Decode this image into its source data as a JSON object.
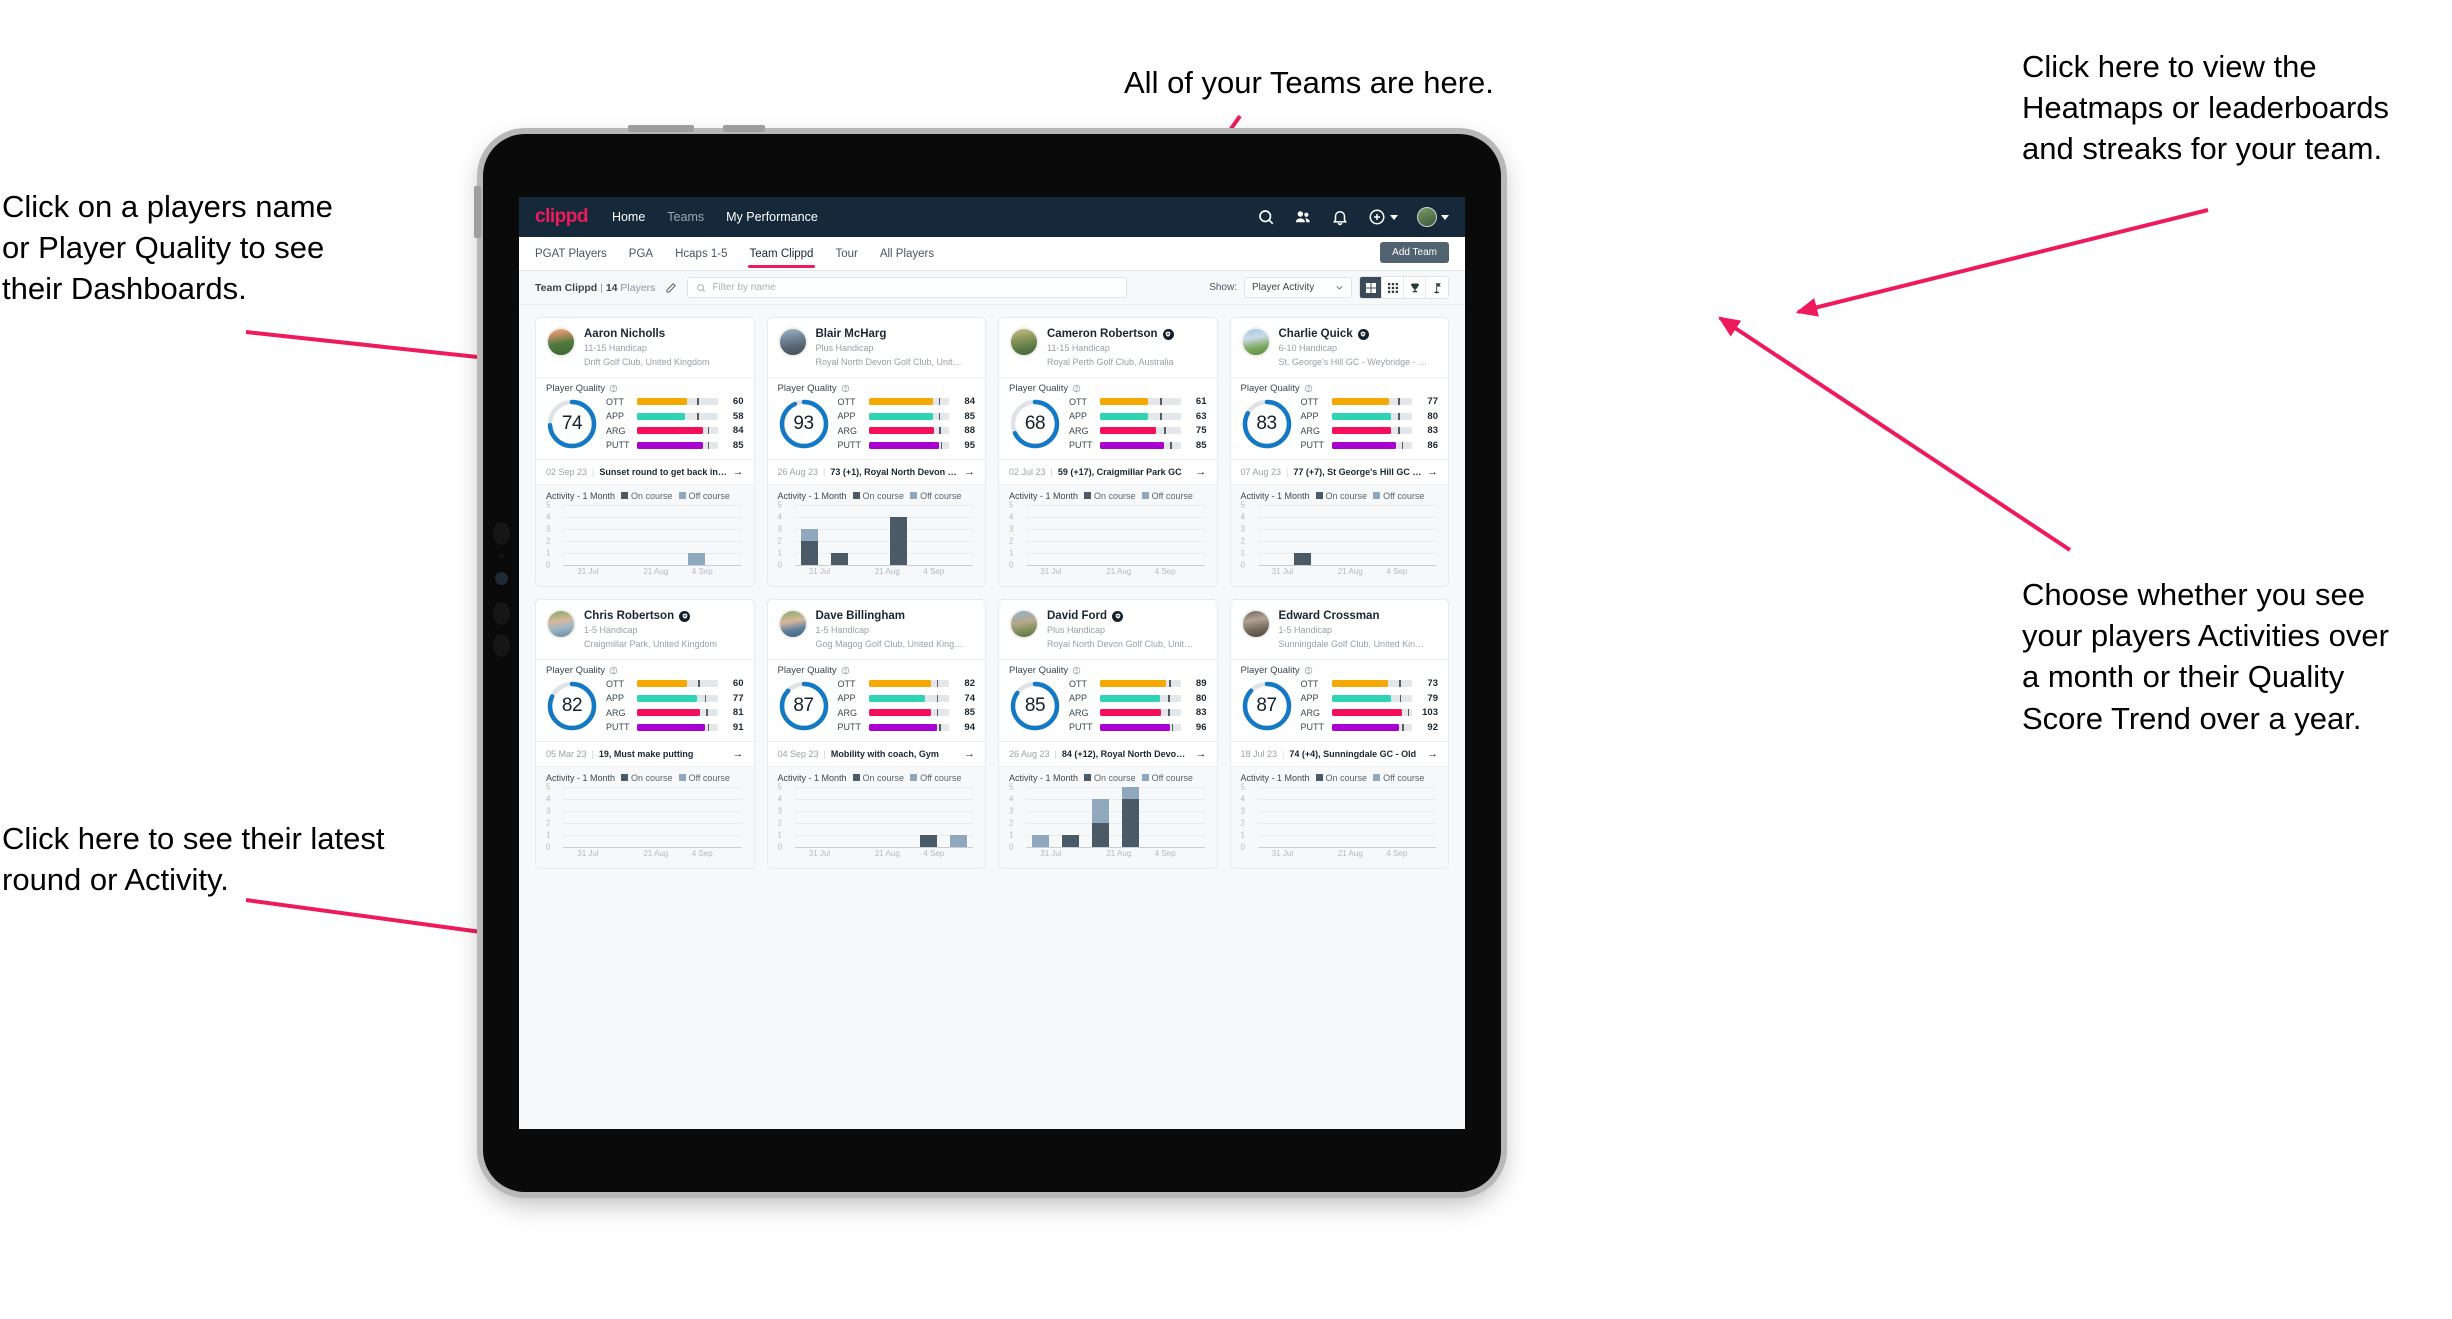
{
  "annotations": [
    {
      "id": "a-left-top",
      "text": "Click on a players name\nor Player Quality to see\ntheir Dashboards."
    },
    {
      "id": "a-top",
      "text": "All of your Teams are here."
    },
    {
      "id": "a-right-top",
      "text": "Click here to view the\nHeatmaps or leaderboards\nand streaks for your team."
    },
    {
      "id": "a-right-bottom",
      "text": "Choose whether you see\nyour players Activities over\na month or their Quality\nScore Trend over a year."
    },
    {
      "id": "a-left-bottom",
      "text": "Click here to see their latest\nround or Activity."
    }
  ],
  "topbar": {
    "logo": "clippd",
    "links": [
      {
        "label": "Home",
        "active": true
      },
      {
        "label": "Teams",
        "active": false
      },
      {
        "label": "My Performance",
        "active": false
      }
    ],
    "icons": [
      "search-icon",
      "people-icon",
      "bell-icon",
      "plus-circle-icon",
      "avatar"
    ]
  },
  "subtabs": {
    "tabs": [
      {
        "label": "PGAT Players",
        "active": false
      },
      {
        "label": "PGA",
        "active": false
      },
      {
        "label": "Hcaps 1-5",
        "active": false
      },
      {
        "label": "Team Clippd",
        "active": true
      },
      {
        "label": "Tour",
        "active": false
      },
      {
        "label": "All Players",
        "active": false
      }
    ],
    "add_team_label": "Add Team"
  },
  "filterbar": {
    "team_name": "Team Clippd",
    "separator": "|",
    "player_count": "14",
    "players_word": "Players",
    "edit_icon": "pencil-icon",
    "search_placeholder": "Filter by name",
    "show_label": "Show:",
    "show_value": "Player Activity",
    "view_buttons": [
      {
        "name": "grid-large-view",
        "active": true
      },
      {
        "name": "grid-small-view",
        "active": false
      },
      {
        "name": "trophy-leaderboard-view",
        "active": false
      },
      {
        "name": "golf-flag-view",
        "active": false
      }
    ]
  },
  "colors": {
    "accent_pink": "#ef1a5b",
    "navy": "#16293a",
    "ring_blue": "#1479c4",
    "ott": "#f5a800",
    "app": "#2fd4b5",
    "arg": "#f50f5a",
    "putt": "#a800d0",
    "on_course": "#4a5a66",
    "off_course": "#8fa8bd"
  },
  "card_labels": {
    "player_quality": "Player Quality",
    "activity": "Activity - 1 Month",
    "on_course": "On course",
    "off_course": "Off course",
    "metrics": [
      "OTT",
      "APP",
      "ARG",
      "PUTT"
    ],
    "y_ticks": [
      "5",
      "4",
      "3",
      "2",
      "1",
      "0"
    ],
    "x_ticks": [
      "31 Jul",
      "21 Aug",
      "4 Sep"
    ]
  },
  "players": [
    {
      "name": "Aaron Nicholls",
      "verified": false,
      "avatar_class": "pa0",
      "handicap": "11-15 Handicap",
      "club": "Drift Golf Club, United Kingdom",
      "quality": 74,
      "metrics": [
        {
          "key": "OTT",
          "value": 60,
          "fill": 62,
          "tick": 75
        },
        {
          "key": "APP",
          "value": 58,
          "fill": 60,
          "tick": 75
        },
        {
          "key": "ARG",
          "value": 84,
          "fill": 82,
          "tick": 88
        },
        {
          "key": "PUTT",
          "value": 85,
          "fill": 82,
          "tick": 88
        }
      ],
      "latest_date": "02 Sep 23",
      "latest_text": "Sunset round to get back into it, F...",
      "activity": [
        {
          "on": 0,
          "off": 0
        },
        {
          "on": 0,
          "off": 0
        },
        {
          "on": 0,
          "off": 0
        },
        {
          "on": 0,
          "off": 0
        },
        {
          "on": 0,
          "off": 1
        },
        {
          "on": 0,
          "off": 0
        }
      ]
    },
    {
      "name": "Blair McHarg",
      "verified": false,
      "avatar_class": "pa1",
      "handicap": "Plus Handicap",
      "club": "Royal North Devon Golf Club, United Kin...",
      "quality": 93,
      "metrics": [
        {
          "key": "OTT",
          "value": 84,
          "fill": 80,
          "tick": 87
        },
        {
          "key": "APP",
          "value": 85,
          "fill": 80,
          "tick": 87
        },
        {
          "key": "ARG",
          "value": 88,
          "fill": 81,
          "tick": 88
        },
        {
          "key": "PUTT",
          "value": 95,
          "fill": 87,
          "tick": 90
        }
      ],
      "latest_date": "26 Aug 23",
      "latest_text": "73 (+1), Royal North Devon GC",
      "activity": [
        {
          "on": 2,
          "off": 1
        },
        {
          "on": 1,
          "off": 0
        },
        {
          "on": 0,
          "off": 0
        },
        {
          "on": 4,
          "off": 0
        },
        {
          "on": 0,
          "off": 0
        },
        {
          "on": 0,
          "off": 0
        }
      ]
    },
    {
      "name": "Cameron Robertson",
      "verified": true,
      "avatar_class": "pa2",
      "handicap": "11-15 Handicap",
      "club": "Royal Perth Golf Club, Australia",
      "quality": 68,
      "metrics": [
        {
          "key": "OTT",
          "value": 61,
          "fill": 60,
          "tick": 75
        },
        {
          "key": "APP",
          "value": 63,
          "fill": 60,
          "tick": 75
        },
        {
          "key": "ARG",
          "value": 75,
          "fill": 70,
          "tick": 80
        },
        {
          "key": "PUTT",
          "value": 85,
          "fill": 80,
          "tick": 87
        }
      ],
      "latest_date": "02 Jul 23",
      "latest_text": "59 (+17), Craigmillar Park GC",
      "activity": [
        {
          "on": 0,
          "off": 0
        },
        {
          "on": 0,
          "off": 0
        },
        {
          "on": 0,
          "off": 0
        },
        {
          "on": 0,
          "off": 0
        },
        {
          "on": 0,
          "off": 0
        },
        {
          "on": 0,
          "off": 0
        }
      ]
    },
    {
      "name": "Charlie Quick",
      "verified": true,
      "avatar_class": "pa3",
      "handicap": "6-10 Handicap",
      "club": "St. George's Hill GC - Weybridge - Surrey, ...",
      "quality": 83,
      "metrics": [
        {
          "key": "OTT",
          "value": 77,
          "fill": 72,
          "tick": 83
        },
        {
          "key": "APP",
          "value": 80,
          "fill": 74,
          "tick": 83
        },
        {
          "key": "ARG",
          "value": 83,
          "fill": 74,
          "tick": 83
        },
        {
          "key": "PUTT",
          "value": 86,
          "fill": 80,
          "tick": 87
        }
      ],
      "latest_date": "07 Aug 23",
      "latest_text": "77 (+7), St George's Hill GC - Red...",
      "activity": [
        {
          "on": 0,
          "off": 0
        },
        {
          "on": 1,
          "off": 0
        },
        {
          "on": 0,
          "off": 0
        },
        {
          "on": 0,
          "off": 0
        },
        {
          "on": 0,
          "off": 0
        },
        {
          "on": 0,
          "off": 0
        }
      ]
    },
    {
      "name": "Chris Robertson",
      "verified": true,
      "avatar_class": "pa4",
      "handicap": "1-5 Handicap",
      "club": "Craigmillar Park, United Kingdom",
      "quality": 82,
      "metrics": [
        {
          "key": "OTT",
          "value": 60,
          "fill": 62,
          "tick": 76
        },
        {
          "key": "APP",
          "value": 77,
          "fill": 74,
          "tick": 84
        },
        {
          "key": "ARG",
          "value": 81,
          "fill": 78,
          "tick": 86
        },
        {
          "key": "PUTT",
          "value": 91,
          "fill": 84,
          "tick": 88
        }
      ],
      "latest_date": "05 Mar 23",
      "latest_text": "19, Must make putting",
      "activity": [
        {
          "on": 0,
          "off": 0
        },
        {
          "on": 0,
          "off": 0
        },
        {
          "on": 0,
          "off": 0
        },
        {
          "on": 0,
          "off": 0
        },
        {
          "on": 0,
          "off": 0
        },
        {
          "on": 0,
          "off": 0
        }
      ]
    },
    {
      "name": "Dave Billingham",
      "verified": false,
      "avatar_class": "pa5",
      "handicap": "1-5 Handicap",
      "club": "Gog Magog Golf Club, United Kingdom",
      "quality": 87,
      "metrics": [
        {
          "key": "OTT",
          "value": 82,
          "fill": 78,
          "tick": 85
        },
        {
          "key": "APP",
          "value": 74,
          "fill": 70,
          "tick": 85
        },
        {
          "key": "ARG",
          "value": 85,
          "fill": 78,
          "tick": 85
        },
        {
          "key": "PUTT",
          "value": 94,
          "fill": 85,
          "tick": 88
        }
      ],
      "latest_date": "04 Sep 23",
      "latest_text": "Mobility with coach, Gym",
      "activity": [
        {
          "on": 0,
          "off": 0
        },
        {
          "on": 0,
          "off": 0
        },
        {
          "on": 0,
          "off": 0
        },
        {
          "on": 0,
          "off": 0
        },
        {
          "on": 1,
          "off": 0
        },
        {
          "on": 0,
          "off": 1
        }
      ]
    },
    {
      "name": "David Ford",
      "verified": true,
      "avatar_class": "pa6",
      "handicap": "Plus Handicap",
      "club": "Royal North Devon Golf Club, United Kin...",
      "quality": 85,
      "metrics": [
        {
          "key": "OTT",
          "value": 89,
          "fill": 82,
          "tick": 86
        },
        {
          "key": "APP",
          "value": 80,
          "fill": 74,
          "tick": 85
        },
        {
          "key": "ARG",
          "value": 83,
          "fill": 76,
          "tick": 85
        },
        {
          "key": "PUTT",
          "value": 96,
          "fill": 87,
          "tick": 89
        }
      ],
      "latest_date": "26 Aug 23",
      "latest_text": "84 (+12), Royal North Devon GC",
      "activity": [
        {
          "on": 0,
          "off": 1
        },
        {
          "on": 1,
          "off": 0
        },
        {
          "on": 2,
          "off": 2
        },
        {
          "on": 4,
          "off": 1
        },
        {
          "on": 0,
          "off": 0
        },
        {
          "on": 0,
          "off": 0
        }
      ]
    },
    {
      "name": "Edward Crossman",
      "verified": false,
      "avatar_class": "pa7",
      "handicap": "1-5 Handicap",
      "club": "Sunningdale Golf Club, United Kingdom",
      "quality": 87,
      "metrics": [
        {
          "key": "OTT",
          "value": 73,
          "fill": 70,
          "tick": 84
        },
        {
          "key": "APP",
          "value": 79,
          "fill": 74,
          "tick": 85
        },
        {
          "key": "ARG",
          "value": 103,
          "fill": 88,
          "tick": 95
        },
        {
          "key": "PUTT",
          "value": 92,
          "fill": 84,
          "tick": 88
        }
      ],
      "latest_date": "18 Jul 23",
      "latest_text": "74 (+4), Sunningdale GC - Old",
      "activity": [
        {
          "on": 0,
          "off": 0
        },
        {
          "on": 0,
          "off": 0
        },
        {
          "on": 0,
          "off": 0
        },
        {
          "on": 0,
          "off": 0
        },
        {
          "on": 0,
          "off": 0
        },
        {
          "on": 0,
          "off": 0
        }
      ]
    }
  ]
}
